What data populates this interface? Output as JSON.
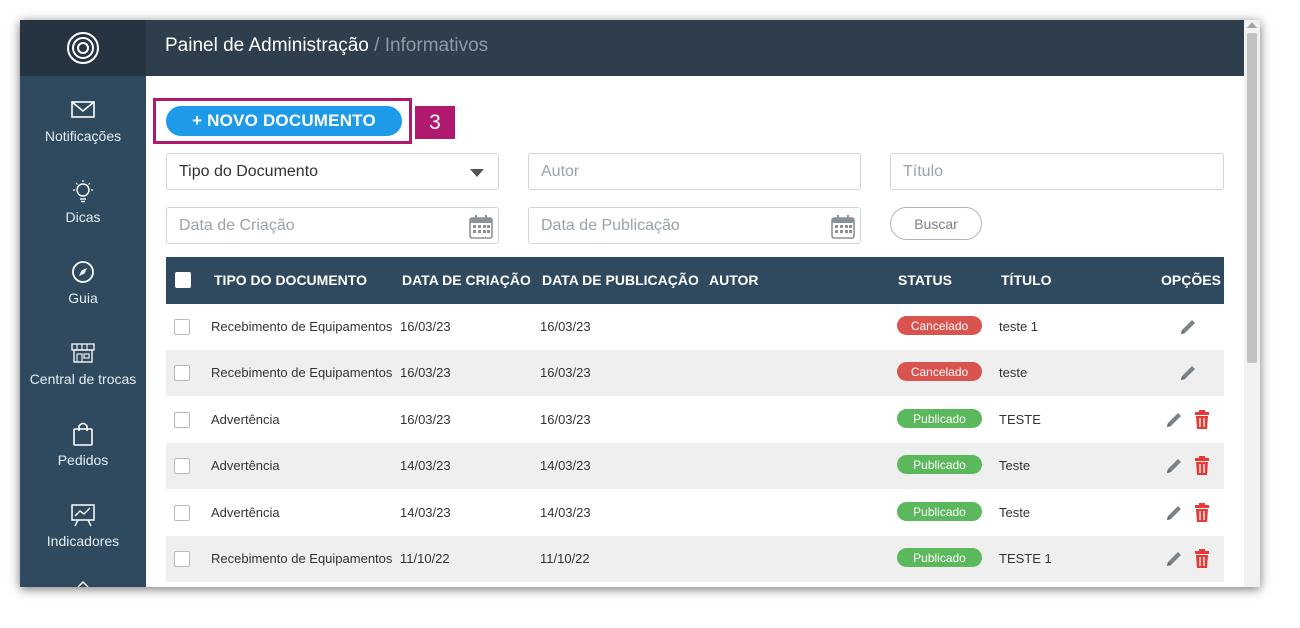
{
  "header": {
    "title": "Painel de Administração",
    "separator": " / ",
    "section": "Informativos"
  },
  "sidebar": {
    "logo_icon": "concentric-circles-logo",
    "items": [
      {
        "label": "Notificações",
        "icon": "envelope-icon"
      },
      {
        "label": "Dicas",
        "icon": "lightbulb-icon"
      },
      {
        "label": "Guia",
        "icon": "compass-icon"
      },
      {
        "label": "Central de trocas",
        "icon": "storefront-icon"
      },
      {
        "label": "Pedidos",
        "icon": "shopping-bag-icon"
      },
      {
        "label": "Indicadores",
        "icon": "chart-board-icon"
      }
    ]
  },
  "toolbar": {
    "new_button": "+ NOVO DOCUMENTO",
    "step_label": "3"
  },
  "filters": {
    "doc_type": "Tipo do Documento",
    "author_placeholder": "Autor",
    "title_placeholder": "Título",
    "created_placeholder": "Data de Criação",
    "published_placeholder": "Data de Publicação",
    "search_button": "Buscar"
  },
  "table": {
    "columns": [
      "TIPO DO DOCUMENTO",
      "DATA DE CRIAÇÃO",
      "DATA DE PUBLICAÇÃO",
      "AUTOR",
      "STATUS",
      "TÍTULO",
      "OPÇÕES"
    ],
    "rows": [
      {
        "type": "Recebimento de Equipamentos",
        "created": "16/03/23",
        "published": "16/03/23",
        "author": "",
        "status": "Cancelado",
        "title": "teste 1"
      },
      {
        "type": "Recebimento de Equipamentos",
        "created": "16/03/23",
        "published": "16/03/23",
        "author": "",
        "status": "Cancelado",
        "title": "teste"
      },
      {
        "type": "Advertência",
        "created": "16/03/23",
        "published": "16/03/23",
        "author": "",
        "status": "Publicado",
        "title": "TESTE"
      },
      {
        "type": "Advertência",
        "created": "14/03/23",
        "published": "14/03/23",
        "author": "",
        "status": "Publicado",
        "title": "Teste"
      },
      {
        "type": "Advertência",
        "created": "14/03/23",
        "published": "14/03/23",
        "author": "",
        "status": "Publicado",
        "title": "Teste"
      },
      {
        "type": "Recebimento de Equipamentos",
        "created": "11/10/22",
        "published": "11/10/22",
        "author": "",
        "status": "Publicado",
        "title": "TESTE 1"
      }
    ]
  },
  "colors": {
    "sidebar": "#2f4a5f",
    "topbar": "#2f3e4d",
    "primary": "#1e9be8",
    "highlight": "#b0196e",
    "cancelled": "#d9534f",
    "published": "#5cb85c",
    "delete": "#e53935"
  }
}
